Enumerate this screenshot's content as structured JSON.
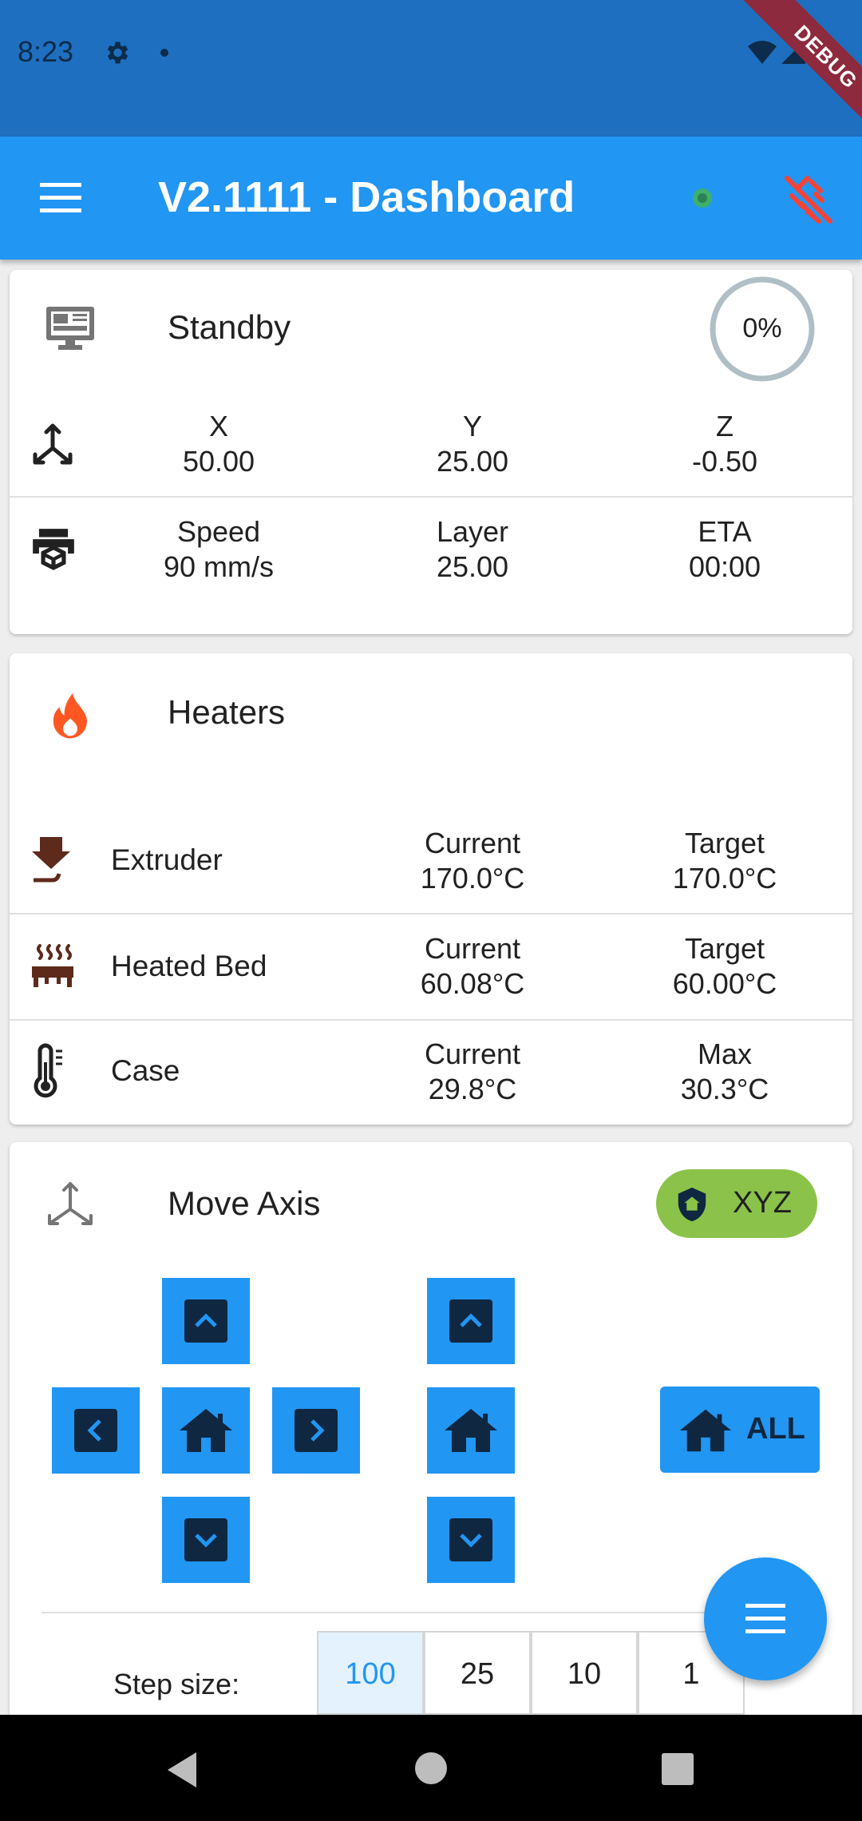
{
  "status_bar": {
    "time": "8:23",
    "debug_banner": "DEBUG"
  },
  "app_bar": {
    "title": "V2.1111 - Dashboard"
  },
  "status_card": {
    "state": "Standby",
    "progress_text": "0%",
    "progress": 0,
    "axes": [
      {
        "label": "X",
        "value": "50.00"
      },
      {
        "label": "Y",
        "value": "25.00"
      },
      {
        "label": "Z",
        "value": "-0.50"
      }
    ],
    "job": [
      {
        "label": "Speed",
        "value": "90 mm/s"
      },
      {
        "label": "Layer",
        "value": "25.00"
      },
      {
        "label": "ETA",
        "value": "00:00"
      }
    ]
  },
  "heaters_card": {
    "title": "Heaters",
    "rows": [
      {
        "name": "Extruder",
        "current_label": "Current",
        "current": "170.0°C",
        "target_label": "Target",
        "target": "170.0°C"
      },
      {
        "name": "Heated Bed",
        "current_label": "Current",
        "current": "60.08°C",
        "target_label": "Target",
        "target": "60.00°C"
      },
      {
        "name": "Case",
        "current_label": "Current",
        "current": "29.8°C",
        "target_label": "Max",
        "target": "30.3°C"
      }
    ]
  },
  "move_card": {
    "title": "Move Axis",
    "homed_badge": "XYZ",
    "home_all_label": "ALL",
    "step_label": "Step size:",
    "steps": [
      "100",
      "25",
      "10",
      "1"
    ],
    "selected_step": "100"
  },
  "colors": {
    "status_bar": "#1e6fbf",
    "app_bar": "#2196f3",
    "homed_badge": "#8bc34a",
    "heater_icon": "#ff5722",
    "disconnect_icon": "#f44336"
  }
}
